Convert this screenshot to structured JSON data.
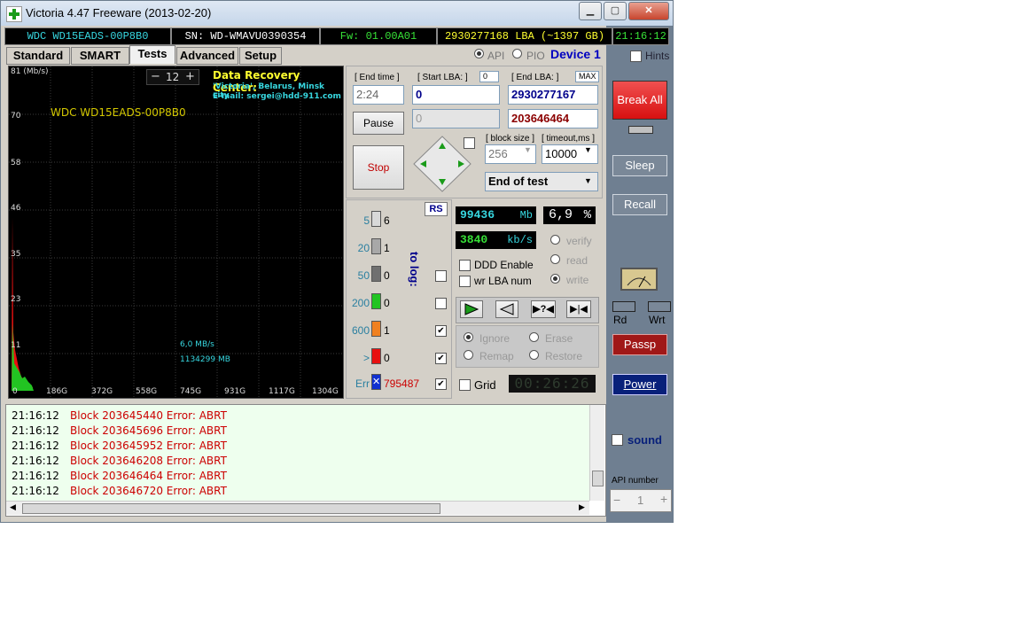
{
  "window": {
    "title": "Victoria 4.47  Freeware (2013-02-20)"
  },
  "infobar": {
    "model": "WDC WD15EADS-00P8B0",
    "serial": "SN: WD-WMAVU0390354",
    "firmware": "Fw: 01.00A01",
    "lba": "2930277168 LBA (~1397 GB)",
    "clock": "21:16:12"
  },
  "tabs": [
    {
      "label": "Standard"
    },
    {
      "label": "SMART"
    },
    {
      "label": "Tests"
    },
    {
      "label": "Advanced"
    },
    {
      "label": "Setup"
    }
  ],
  "interface": {
    "api": "API",
    "pio": "PIO",
    "device": "Device 1",
    "hints": "Hints"
  },
  "graph": {
    "zoom_minus": "−",
    "zoom_value": "12",
    "zoom_plus": "+",
    "unit": "81 (Mb/s)",
    "drive_label": "WDC WD15EADS-00P8B0",
    "y_ticks": [
      "70",
      "58",
      "46",
      "35",
      "23",
      "11"
    ],
    "x_ticks": [
      "0",
      "186G",
      "372G",
      "558G",
      "745G",
      "931G",
      "1117G",
      "1304G"
    ],
    "speed_readout": "6,0 MB/s",
    "position_readout": "1134299 MB",
    "drc_title": "Data Recovery Center:",
    "drc_line1": "'Victoria', Belarus, Minsk city",
    "drc_line2": "E-mail: sergei@hdd-911.com"
  },
  "controls": {
    "end_time_label": "[ End time ]",
    "end_time": "2:24",
    "start_lba_label": "[ Start LBA: ]",
    "start_lba_zero": "0",
    "start_lba": "0",
    "end_lba_label": "[ End LBA: ]",
    "max_label": "MAX",
    "end_lba": "2930277167",
    "current_lba_dim": "0",
    "current_lba": "203646464",
    "pause": "Pause",
    "stop": "Stop",
    "block_size_label": "[ block size ]",
    "block_size": "256",
    "timeout_label": "[ timeout,ms ]",
    "timeout": "10000",
    "end_action": "End of test"
  },
  "blocks": {
    "rows": [
      {
        "ms": "5",
        "count": "6",
        "color": "#d8d8d8",
        "log": ""
      },
      {
        "ms": "20",
        "count": "1",
        "color": "#a8a8a8",
        "log": ""
      },
      {
        "ms": "50",
        "count": "0",
        "color": "#707070",
        "log": ""
      },
      {
        "ms": "200",
        "count": "0",
        "color": "#22c422",
        "log": ""
      },
      {
        "ms": "600",
        "count": "1",
        "color": "#f08020",
        "log": "✔"
      },
      {
        "ms": ">",
        "count": "0",
        "color": "#e81010",
        "log": "✔"
      }
    ],
    "err_label": "Err",
    "err_icon": "x-icon",
    "err_count": "795487",
    "err_log": "✔",
    "rs": "RS",
    "to_log": "to log:"
  },
  "stats": {
    "mb": "99436",
    "mb_unit": "Mb",
    "percent": "6,9",
    "percent_unit": "%",
    "speed": "3840",
    "speed_unit": "kb/s"
  },
  "options": {
    "ddd": "DDD Enable",
    "wrlba": "wr LBA num",
    "verify": "verify",
    "read": "read",
    "write": "write",
    "ignore": "Ignore",
    "erase": "Erase",
    "remap": "Remap",
    "restore": "Restore",
    "grid": "Grid",
    "timer": "00:26:26"
  },
  "side": {
    "break_all": "Break All",
    "sleep": "Sleep",
    "recall": "Recall",
    "rd": "Rd",
    "wrt": "Wrt",
    "passp": "Passp",
    "power": "Power",
    "sound": "sound",
    "api_number_label": "API number",
    "api_minus": "−",
    "api_number": "1",
    "api_plus": "+"
  },
  "log": [
    {
      "time": "21:16:12",
      "msg": "Block 203645440 Error: ABRT"
    },
    {
      "time": "21:16:12",
      "msg": "Block 203645696 Error: ABRT"
    },
    {
      "time": "21:16:12",
      "msg": "Block 203645952 Error: ABRT"
    },
    {
      "time": "21:16:12",
      "msg": "Block 203646208 Error: ABRT"
    },
    {
      "time": "21:16:12",
      "msg": "Block 203646464 Error: ABRT"
    },
    {
      "time": "21:16:12",
      "msg": "Block 203646720 Error: ABRT"
    }
  ],
  "colors": {
    "log_error": "#cc0000",
    "cyan": "#37d7e0",
    "yellow": "#ffff30",
    "green": "#37e037"
  }
}
